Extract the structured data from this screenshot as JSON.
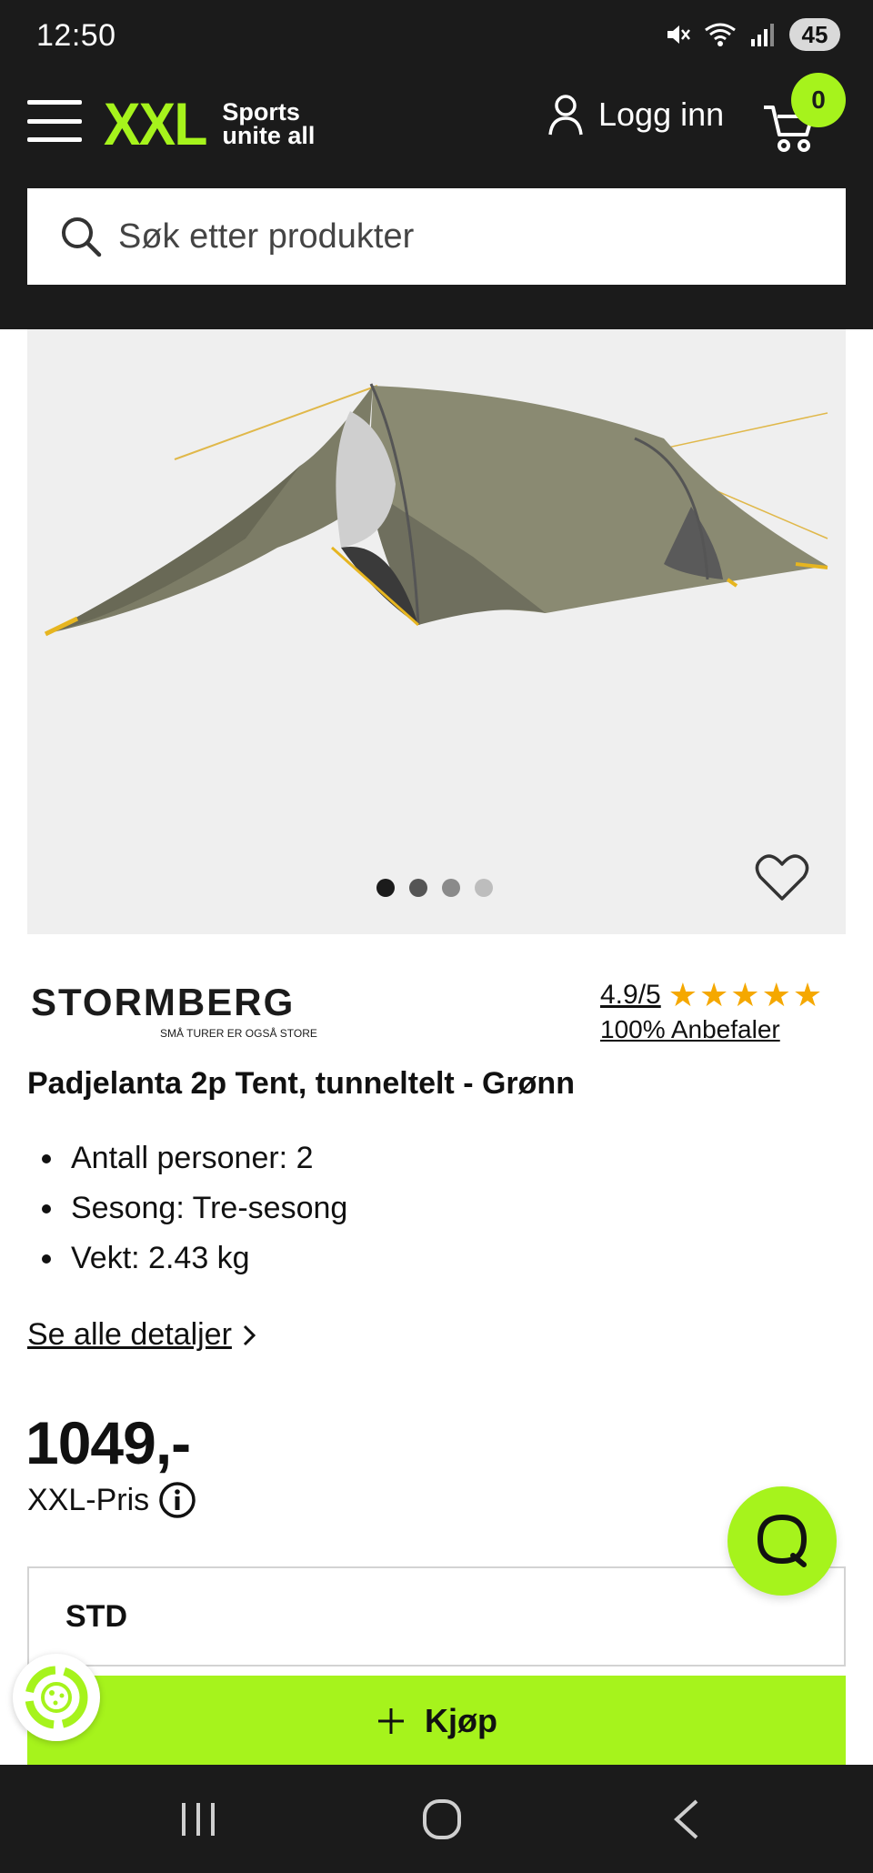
{
  "status_bar": {
    "time": "12:50",
    "battery": "45",
    "icons": [
      "mute-icon",
      "wifi-icon",
      "signal-icon"
    ]
  },
  "header": {
    "logo": "XXL",
    "tagline_line1": "Sports",
    "tagline_line2": "unite all",
    "login_label": "Logg inn",
    "cart_count": "0",
    "search_placeholder": "Søk etter produkter",
    "accent_color": "#a6f31c",
    "background_color": "#1b1b1b"
  },
  "gallery": {
    "image_count": 4,
    "active_index": 0
  },
  "product": {
    "brand": "STORMBERG",
    "brand_tagline": "SMÅ TURER ER OGSÅ STORE",
    "rating": "4.9/5",
    "rating_stars": 5,
    "recommend": "100% Anbefaler",
    "title": "Padjelanta 2p Tent, tunneltelt - Grønn",
    "features": [
      "Antall personer: 2",
      "Sesong: Tre-sesong",
      "Vekt: 2.43 kg"
    ],
    "details_link": "Se alle detaljer",
    "price": "1049,-",
    "price_label": "XXL-Pris",
    "size_value": "STD",
    "buy_label": "Kjøp"
  },
  "nav": {
    "items": [
      "recent-apps-icon",
      "home-icon",
      "back-icon"
    ]
  }
}
